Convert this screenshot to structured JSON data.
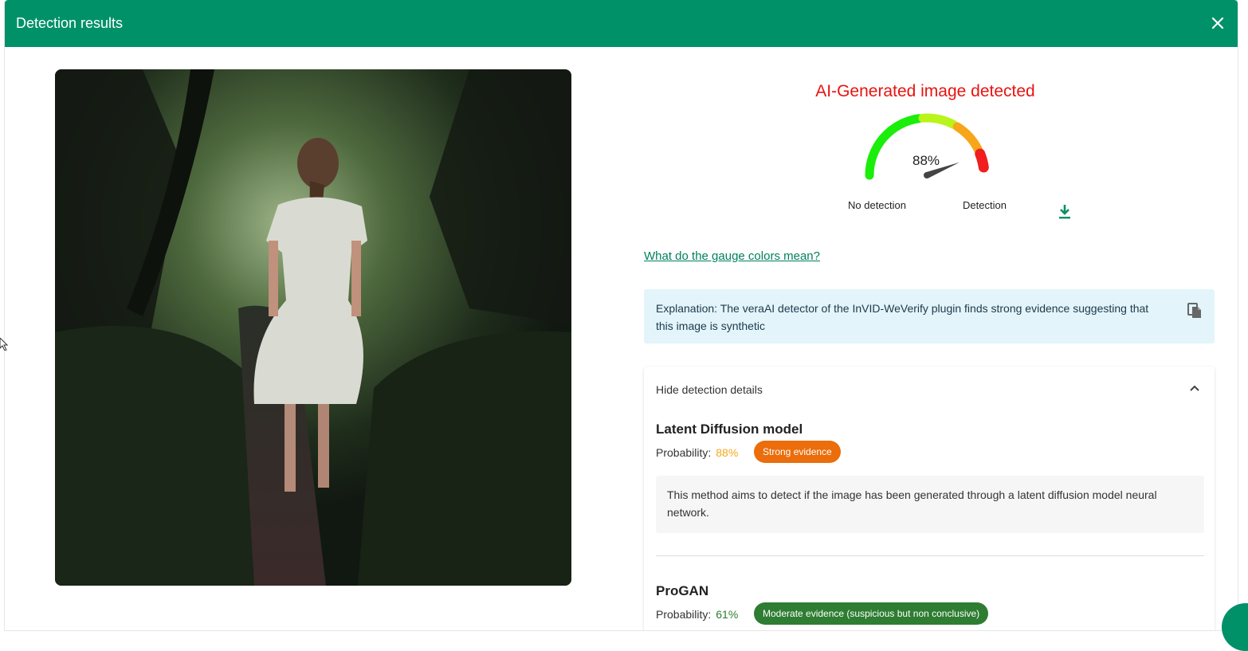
{
  "dialog": {
    "title": "Detection results",
    "close_icon": "close-icon"
  },
  "result": {
    "verdict": "AI-Generated image detected",
    "gauge": {
      "value_text": "88%",
      "value": 0.88,
      "label_low": "No detection",
      "label_high": "Detection",
      "segment_colors": [
        "#1aee0a",
        "#b9f41a",
        "#f7a51b",
        "#f01e1e"
      ]
    },
    "download_icon": "download-icon",
    "gauge_help_link": "What do the gauge colors mean?",
    "explanation": "Explanation: The veraAI detector of the InVID-WeVerify plugin finds strong evidence suggesting that this image is synthetic",
    "copy_icon": "copy-icon"
  },
  "details": {
    "toggle_label": "Hide detection details",
    "models": [
      {
        "name": "Latent Diffusion model",
        "probability_label": "Probability:",
        "probability": "88%",
        "probability_color": "#f6a71c",
        "evidence": "Strong evidence",
        "evidence_color": "#eb6d0b",
        "description": "This method aims to detect if the image has been generated through a latent diffusion model neural network."
      },
      {
        "name": "ProGAN",
        "probability_label": "Probability:",
        "probability": "61%",
        "probability_color": "#2e7d32",
        "evidence": "Moderate evidence (suspicious but non conclusive)",
        "evidence_color": "#2e7d32"
      }
    ]
  },
  "colors": {
    "header": "#009169",
    "verdict": "#e8130f",
    "explanation_bg": "#e3f4fb"
  }
}
